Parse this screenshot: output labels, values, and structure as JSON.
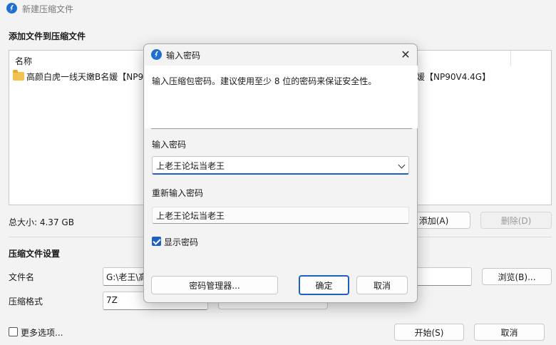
{
  "window": {
    "title": "新建压缩文件"
  },
  "add_section": {
    "title": "添加文件到压缩文件",
    "column_name": "名称",
    "file_name_left": "高颜白虎一线天嫩B名媛【NP90",
    "file_name_right": "媛【NP90V4.4G】",
    "total_size": "总大小: 4.37 GB",
    "add_button": "添加(A)",
    "delete_button": "删除(D)"
  },
  "settings": {
    "title": "压缩文件设置",
    "filename_label": "文件名",
    "filename_value": "G:\\老王\\高",
    "browse_button": "浏览(B)...",
    "format_label": "压缩格式",
    "format_value": "7Z",
    "more_options": "更多选项...",
    "start_button": "开始(S)",
    "cancel_button": "取消"
  },
  "dialog": {
    "title": "输入密码",
    "description": "输入压缩包密码。建议使用至少 8 位的密码来保证安全性。",
    "password_label": "输入密码",
    "password_value": "上老王论坛当老王",
    "reenter_label": "重新输入密码",
    "reenter_value": "上老王论坛当老王",
    "show_password_label": "显示密码",
    "show_password_checked": true,
    "manager_button": "密码管理器...",
    "ok_button": "确定",
    "cancel_button": "取消"
  }
}
